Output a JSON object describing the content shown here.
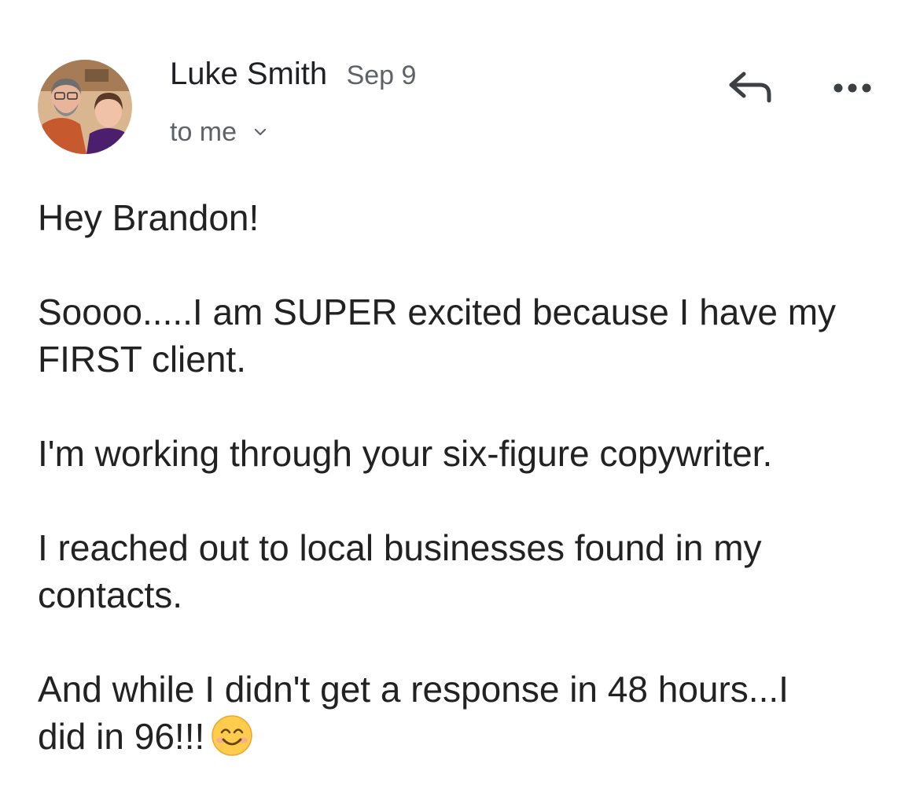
{
  "email": {
    "sender_name": "Luke Smith",
    "date": "Sep 9",
    "recipient": "to me",
    "paragraphs": [
      {
        "lines": [
          "Hey Brandon!"
        ]
      },
      {
        "lines": [
          "Soooo.....I am SUPER excited because I have my",
          "FIRST client."
        ]
      },
      {
        "lines": [
          "I'm working through your six-figure copywriter."
        ]
      },
      {
        "lines": [
          "I reached out to local businesses found in my",
          "contacts."
        ]
      },
      {
        "lines": [
          "And while I didn't get a response in 48 hours...I",
          "did in 96!!!"
        ]
      }
    ],
    "trailing_emoji": "smiling-face-with-smiling-eyes"
  },
  "icons": {
    "avatar": "avatar-photo",
    "recipient_toggle": "chevron-down-icon",
    "reply": "reply-icon",
    "more": "more-options-icon"
  },
  "colors": {
    "text": "#222222",
    "secondary_text": "#5f6368",
    "emoji_face": "#FFCC4D"
  }
}
